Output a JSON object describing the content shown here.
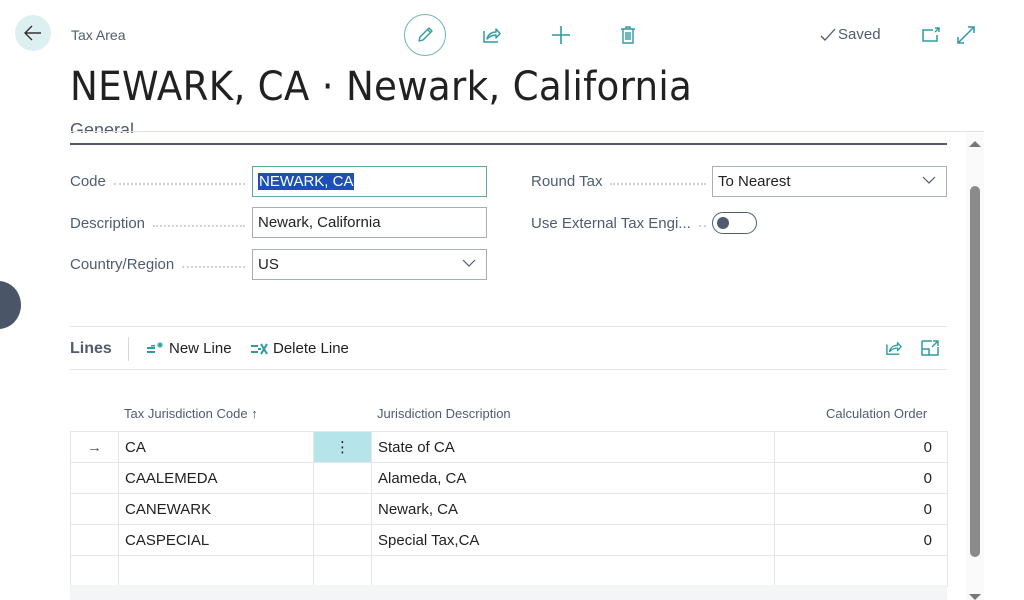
{
  "header": {
    "breadcrumb": "Tax Area",
    "title": "NEWARK, CA · Newark, California",
    "saved_status": "Saved",
    "icons": {
      "back": "arrow-left-icon",
      "edit": "pencil-icon",
      "share": "share-icon",
      "new": "plus-icon",
      "delete": "trash-icon",
      "open_new_window": "open-in-new-window-icon",
      "expand": "expand-icon"
    }
  },
  "general": {
    "section_title": "General",
    "fields": {
      "code": {
        "label": "Code",
        "value": "NEWARK, CA"
      },
      "description": {
        "label": "Description",
        "value": "Newark, California"
      },
      "country_region": {
        "label": "Country/Region",
        "value": "US"
      },
      "round_tax": {
        "label": "Round Tax",
        "value": "To Nearest"
      },
      "use_external_tax_engine": {
        "label": "Use External Tax Engi...",
        "value": false
      }
    }
  },
  "lines": {
    "title": "Lines",
    "actions": {
      "new_line": "New Line",
      "delete_line": "Delete Line"
    },
    "columns": {
      "code": "Tax Jurisdiction Code",
      "code_sort": "↑",
      "description": "Jurisdiction Description",
      "calc_order": "Calculation Order"
    },
    "rows": [
      {
        "code": "CA",
        "description": "State of CA",
        "calc_order": "0",
        "active": true
      },
      {
        "code": "CAALEMEDA",
        "description": "Alameda, CA",
        "calc_order": "0"
      },
      {
        "code": "CANEWARK",
        "description": "Newark, CA",
        "calc_order": "0"
      },
      {
        "code": "CASPECIAL",
        "description": "Special Tax,CA",
        "calc_order": "0"
      }
    ],
    "row_marker": "→",
    "row_menu": "⋮"
  },
  "colors": {
    "accent": "#2e9ba3",
    "selection": "#1f4fb6",
    "active_cell": "#b5e5ea"
  }
}
